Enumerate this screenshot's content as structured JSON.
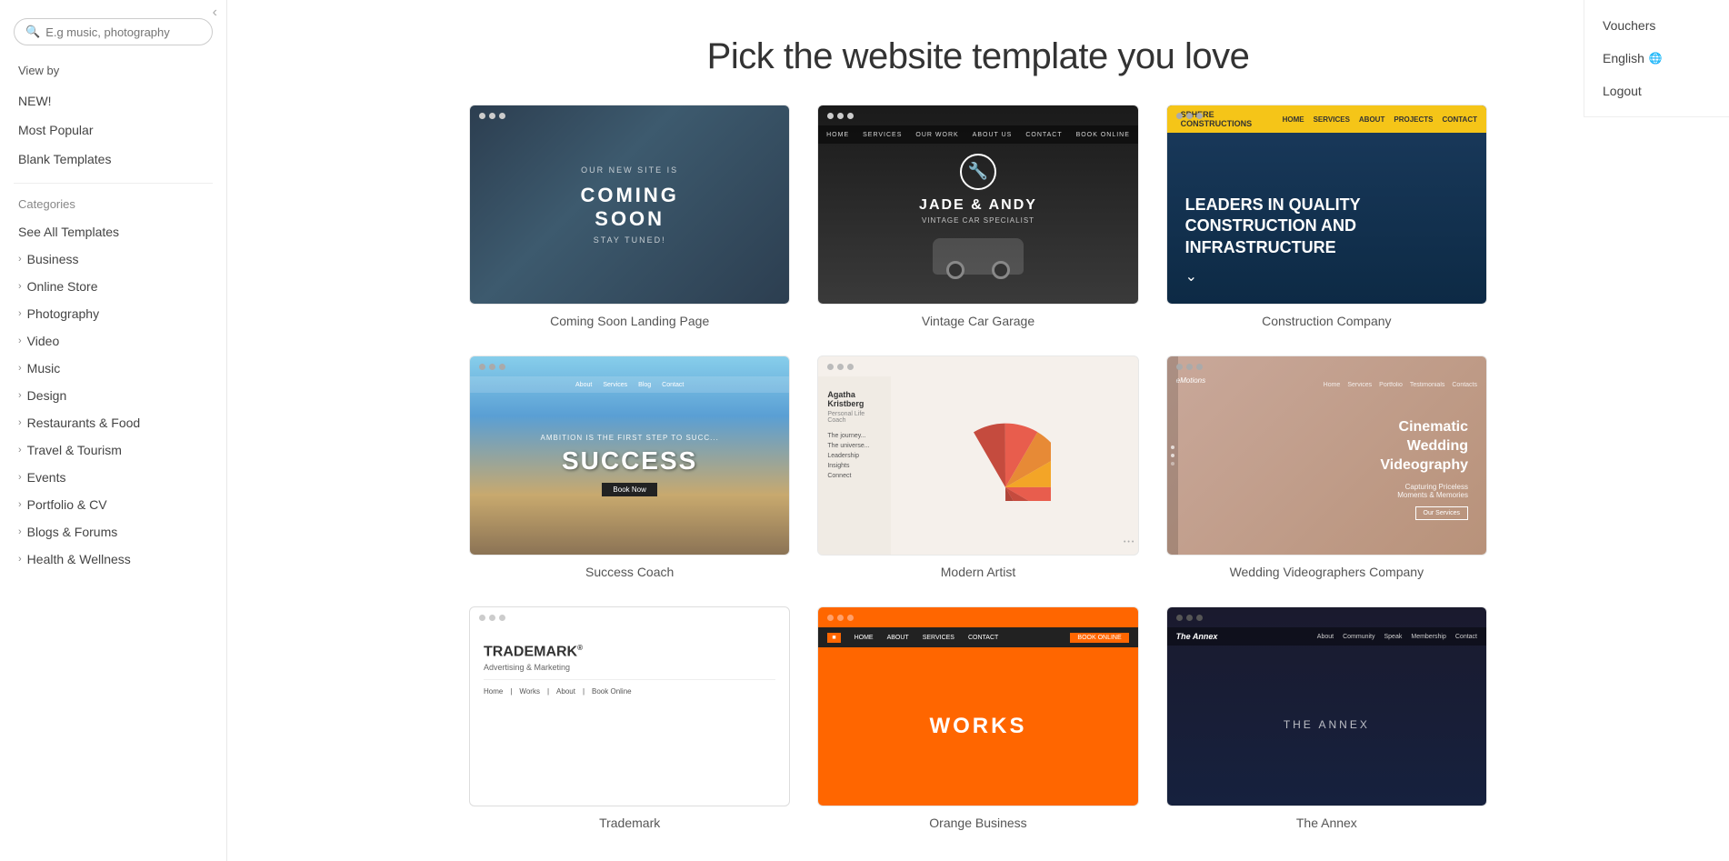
{
  "header": {
    "title": "Pick the website template you love"
  },
  "top_right_menu": {
    "items": [
      {
        "id": "vouchers",
        "label": "Vouchers"
      },
      {
        "id": "english",
        "label": "English",
        "has_globe": true
      },
      {
        "id": "logout",
        "label": "Logout"
      }
    ]
  },
  "sidebar": {
    "search_placeholder": "E.g music, photography",
    "view_by_label": "View by",
    "quick_items": [
      {
        "id": "new",
        "label": "NEW!"
      },
      {
        "id": "most-popular",
        "label": "Most Popular"
      },
      {
        "id": "blank-templates",
        "label": "Blank Templates"
      }
    ],
    "categories_label": "Categories",
    "category_items": [
      {
        "id": "see-all",
        "label": "See All Templates",
        "active": true
      },
      {
        "id": "business",
        "label": "Business"
      },
      {
        "id": "online-store",
        "label": "Online Store"
      },
      {
        "id": "photography",
        "label": "Photography"
      },
      {
        "id": "video",
        "label": "Video"
      },
      {
        "id": "music",
        "label": "Music"
      },
      {
        "id": "design",
        "label": "Design"
      },
      {
        "id": "restaurants-food",
        "label": "Restaurants & Food"
      },
      {
        "id": "travel-tourism",
        "label": "Travel & Tourism"
      },
      {
        "id": "events",
        "label": "Events"
      },
      {
        "id": "portfolio-cv",
        "label": "Portfolio & CV"
      },
      {
        "id": "blogs-forums",
        "label": "Blogs & Forums"
      },
      {
        "id": "health-wellness",
        "label": "Health & Wellness"
      }
    ]
  },
  "templates": [
    {
      "id": "coming-soon",
      "name": "Coming Soon Landing Page",
      "type": "coming-soon"
    },
    {
      "id": "vintage-car",
      "name": "Vintage Car Garage",
      "type": "car-garage"
    },
    {
      "id": "construction",
      "name": "Construction Company",
      "type": "construction"
    },
    {
      "id": "success-coach",
      "name": "Success Coach",
      "type": "success"
    },
    {
      "id": "modern-artist",
      "name": "Modern Artist",
      "type": "modern-artist"
    },
    {
      "id": "wedding-video",
      "name": "Wedding Videographers Company",
      "type": "wedding"
    },
    {
      "id": "trademark",
      "name": "Trademark",
      "type": "trademark"
    },
    {
      "id": "orange-site",
      "name": "Orange Business",
      "type": "orange"
    },
    {
      "id": "dark-annex",
      "name": "The Annex",
      "type": "dark"
    }
  ]
}
